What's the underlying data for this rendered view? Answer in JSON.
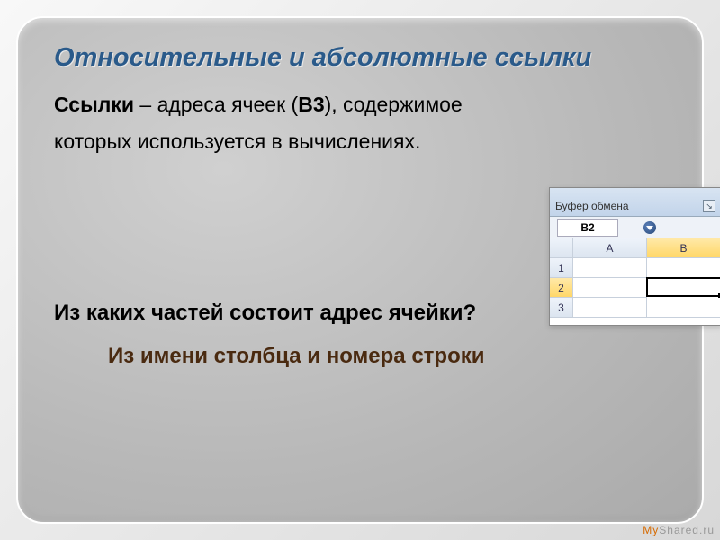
{
  "title": "Относительные и абсолютные ссылки",
  "body": {
    "lead": "Ссылки",
    "line1_rest": " – адреса ячеек (",
    "cell_ref": "В3",
    "line1_tail": "), содержимое",
    "line2": "которых используется в вычислениях."
  },
  "question": "Из каких частей состоит адрес ячейки?",
  "answer": "Из имени столбца и номера строки",
  "excel": {
    "ribbon_label": "Буфер обмена",
    "launcher_glyph": "↘",
    "name_box": "B2",
    "columns": [
      "A",
      "B"
    ],
    "rows": [
      "1",
      "2",
      "3"
    ]
  },
  "watermark": {
    "a": "My",
    "b": "Shared",
    "c": ".ru"
  }
}
